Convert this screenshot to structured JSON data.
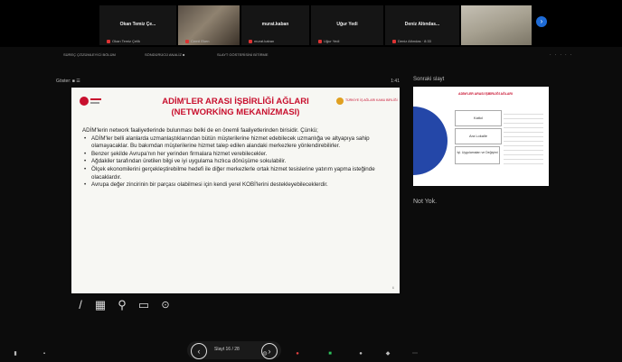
{
  "participants": [
    {
      "name": "Okan Temiz Çe...",
      "sub": "Okan Temiz Çelik"
    },
    {
      "name": "",
      "sub": "Cemil Eken"
    },
    {
      "name": "murat.kaban",
      "sub": "murat.kaban"
    },
    {
      "name": "Uğur Yedi",
      "sub": "Uğur Yedi"
    },
    {
      "name": "Deniz Altındas...",
      "sub": "Deniz Altındas · 8:33"
    },
    {
      "name": "",
      "sub": ""
    }
  ],
  "share_toolbar": {
    "items": [
      "SÜREÇ ÇÖZÜMLEYİCİ BÖLÜM",
      "SÖNDÜRÜCÜ ANALİZ ■",
      "SLAYT GÖSTERİSİNİ BİTİRME"
    ]
  },
  "slide_header": {
    "label": "Göster: ■ ☰",
    "right": "1:41"
  },
  "slide": {
    "title_line1": "ADİM'LER ARASI İŞBİRLİĞİ AĞLARI",
    "title_line2": "(NETWORKİNG MEKANİZMASI)",
    "right_logo": "TÜRKİYE İŞ AĞLARI KAMU BİRLİĞİ",
    "intro": "ADİM'lerin network faaliyetlerinde bulunması belki de en önemli faaliyetlerinden birisidir. Çünkü;",
    "bullets": [
      "ADİM'ler belli alanlarda uzmanlaştıklarından bütün müşterilerine hizmet edebilecek uzmanlığa ve altyapıya sahip olamayacaklar. Bu bakımdan müşterilerine hizmet talep edilen alandaki merkezlere yönlendirebilirler.",
      "Benzer şekilde Avrupa'nın her yerinden firmalara hizmet verebilecekler.",
      "Ağdakiler tarafından üretilen bilgi ve iyi uygulama hızlıca dönüşüme sokulabilir.",
      "Ölçek ekonomilerini gerçekleştirebilme hedefi ile diğer merkezlerle ortak hizmet tesislerine yatırım yapma isteğinde olacaklardır.",
      "Avrupa değer zincirinin bir parçası olabilmesi için kendi yerel KOBİ'lerini destekleyebileceklerdir."
    ],
    "page": "6"
  },
  "right_panel": {
    "next_slide_label": "Sonraki slayt",
    "thumb_title": "ADİM'LER ARASI İŞBİRLİĞİ AĞLARI",
    "thumb_rows": [
      "Katkıl",
      "Ara Lokalle",
      "İşl. Uygulamaları ve Değişimi"
    ],
    "notes": "Not Yok."
  },
  "nav": {
    "text": "Slayt 16 / 28"
  },
  "colors": {
    "title_red": "#c8102e",
    "accent_blue": "#1e6bd6"
  }
}
